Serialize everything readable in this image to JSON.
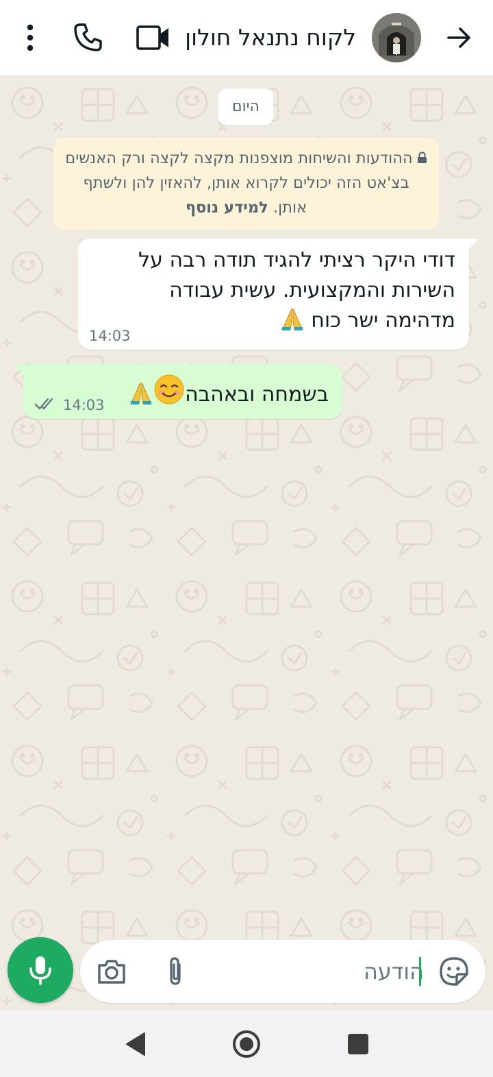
{
  "header": {
    "contact_name": "לקוח נתנאל חולון",
    "back_icon": "arrow-right-icon",
    "video_icon": "video-camera-icon",
    "call_icon": "phone-icon",
    "menu_icon": "more-vert-icon"
  },
  "chat": {
    "date_label": "היום",
    "encryption_notice": {
      "text": "ההודעות והשיחות מוצפנות מקצה לקצה ורק האנשים בצ'אט הזה יכולים לקרוא אותן, להאזין להן ולשתף אותן.",
      "link": "למידע נוסף"
    },
    "messages": [
      {
        "direction": "incoming",
        "text": "דודי היקר רציתי להגיד תודה רבה על השירות והמקצועית. עשית עבודה מדהימה ישר כוח",
        "emoji": "🙏",
        "time": "14:03"
      },
      {
        "direction": "outgoing",
        "text": "בשמחה ובאהבה",
        "emoji": "☺️🙏",
        "time": "14:03",
        "status": "read"
      }
    ]
  },
  "composer": {
    "placeholder": "הודעה",
    "sticker_icon": "sticker-icon",
    "attach_icon": "paperclip-icon",
    "camera_icon": "camera-icon",
    "mic_icon": "microphone-icon"
  },
  "colors": {
    "accent": "#1daa61",
    "outgoing_bubble": "#d9fdd3",
    "incoming_bubble": "#ffffff",
    "chat_background": "#efeae2",
    "encryption_note_bg": "#fdf3d9"
  }
}
